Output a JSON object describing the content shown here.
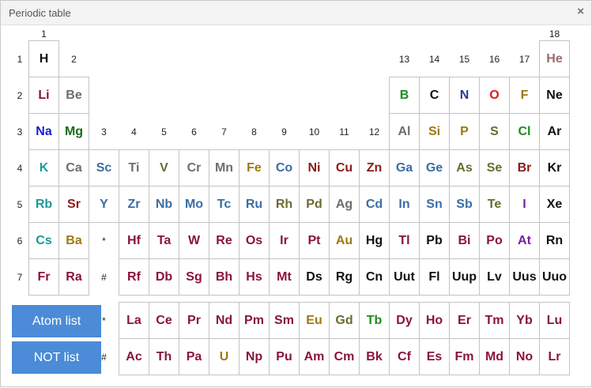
{
  "dialog": {
    "title": "Periodic table",
    "close_label": "×"
  },
  "buttons": {
    "atom_list": "Atom list",
    "not_list": "NOT list"
  },
  "group_labels": [
    "1",
    "2",
    "3",
    "4",
    "5",
    "6",
    "7",
    "8",
    "9",
    "10",
    "11",
    "12",
    "13",
    "14",
    "15",
    "16",
    "17",
    "18"
  ],
  "period_labels": [
    "1",
    "2",
    "3",
    "4",
    "5",
    "6",
    "7"
  ],
  "markers": {
    "lanthanide_row": "*",
    "actinide_row": "#"
  },
  "colors": {
    "dark": "#111111",
    "gray": "#6e6e6e",
    "maroon": "#8a1538",
    "steel": "#3a6ea5",
    "olive": "#6b6b2f",
    "teal": "#1a9a9a",
    "gold": "#a07810",
    "green": "#1e8c1e",
    "navy": "#2b3b8f",
    "red": "#e31a1a",
    "darkred": "#8b1a1a",
    "purple": "#7a1fa2",
    "mauve": "#9a6a6a",
    "blue": "#1a1ad0",
    "grayblue": "#7a8a9a",
    "darkgreen": "#1a6a1a"
  },
  "elements": [
    {
      "s": "H",
      "r": 1,
      "c": 1,
      "k": "dark"
    },
    {
      "s": "He",
      "r": 1,
      "c": 18,
      "k": "mauve"
    },
    {
      "s": "Li",
      "r": 2,
      "c": 1,
      "k": "maroon"
    },
    {
      "s": "Be",
      "r": 2,
      "c": 2,
      "k": "gray"
    },
    {
      "s": "B",
      "r": 2,
      "c": 13,
      "k": "green"
    },
    {
      "s": "C",
      "r": 2,
      "c": 14,
      "k": "dark"
    },
    {
      "s": "N",
      "r": 2,
      "c": 15,
      "k": "navy"
    },
    {
      "s": "O",
      "r": 2,
      "c": 16,
      "k": "red"
    },
    {
      "s": "F",
      "r": 2,
      "c": 17,
      "k": "gold"
    },
    {
      "s": "Ne",
      "r": 2,
      "c": 18,
      "k": "dark"
    },
    {
      "s": "Na",
      "r": 3,
      "c": 1,
      "k": "blue"
    },
    {
      "s": "Mg",
      "r": 3,
      "c": 2,
      "k": "darkgreen"
    },
    {
      "s": "Al",
      "r": 3,
      "c": 13,
      "k": "gray"
    },
    {
      "s": "Si",
      "r": 3,
      "c": 14,
      "k": "gold"
    },
    {
      "s": "P",
      "r": 3,
      "c": 15,
      "k": "gold"
    },
    {
      "s": "S",
      "r": 3,
      "c": 16,
      "k": "olive"
    },
    {
      "s": "Cl",
      "r": 3,
      "c": 17,
      "k": "green"
    },
    {
      "s": "Ar",
      "r": 3,
      "c": 18,
      "k": "dark"
    },
    {
      "s": "K",
      "r": 4,
      "c": 1,
      "k": "teal"
    },
    {
      "s": "Ca",
      "r": 4,
      "c": 2,
      "k": "gray"
    },
    {
      "s": "Sc",
      "r": 4,
      "c": 3,
      "k": "steel"
    },
    {
      "s": "Ti",
      "r": 4,
      "c": 4,
      "k": "gray"
    },
    {
      "s": "V",
      "r": 4,
      "c": 5,
      "k": "olive"
    },
    {
      "s": "Cr",
      "r": 4,
      "c": 6,
      "k": "gray"
    },
    {
      "s": "Mn",
      "r": 4,
      "c": 7,
      "k": "gray"
    },
    {
      "s": "Fe",
      "r": 4,
      "c": 8,
      "k": "gold"
    },
    {
      "s": "Co",
      "r": 4,
      "c": 9,
      "k": "steel"
    },
    {
      "s": "Ni",
      "r": 4,
      "c": 10,
      "k": "darkred"
    },
    {
      "s": "Cu",
      "r": 4,
      "c": 11,
      "k": "darkred"
    },
    {
      "s": "Zn",
      "r": 4,
      "c": 12,
      "k": "darkred"
    },
    {
      "s": "Ga",
      "r": 4,
      "c": 13,
      "k": "steel"
    },
    {
      "s": "Ge",
      "r": 4,
      "c": 14,
      "k": "steel"
    },
    {
      "s": "As",
      "r": 4,
      "c": 15,
      "k": "olive"
    },
    {
      "s": "Se",
      "r": 4,
      "c": 16,
      "k": "olive"
    },
    {
      "s": "Br",
      "r": 4,
      "c": 17,
      "k": "darkred"
    },
    {
      "s": "Kr",
      "r": 4,
      "c": 18,
      "k": "dark"
    },
    {
      "s": "Rb",
      "r": 5,
      "c": 1,
      "k": "teal"
    },
    {
      "s": "Sr",
      "r": 5,
      "c": 2,
      "k": "darkred"
    },
    {
      "s": "Y",
      "r": 5,
      "c": 3,
      "k": "steel"
    },
    {
      "s": "Zr",
      "r": 5,
      "c": 4,
      "k": "steel"
    },
    {
      "s": "Nb",
      "r": 5,
      "c": 5,
      "k": "steel"
    },
    {
      "s": "Mo",
      "r": 5,
      "c": 6,
      "k": "steel"
    },
    {
      "s": "Tc",
      "r": 5,
      "c": 7,
      "k": "steel"
    },
    {
      "s": "Ru",
      "r": 5,
      "c": 8,
      "k": "steel"
    },
    {
      "s": "Rh",
      "r": 5,
      "c": 9,
      "k": "olive"
    },
    {
      "s": "Pd",
      "r": 5,
      "c": 10,
      "k": "olive"
    },
    {
      "s": "Ag",
      "r": 5,
      "c": 11,
      "k": "gray"
    },
    {
      "s": "Cd",
      "r": 5,
      "c": 12,
      "k": "steel"
    },
    {
      "s": "In",
      "r": 5,
      "c": 13,
      "k": "steel"
    },
    {
      "s": "Sn",
      "r": 5,
      "c": 14,
      "k": "steel"
    },
    {
      "s": "Sb",
      "r": 5,
      "c": 15,
      "k": "steel"
    },
    {
      "s": "Te",
      "r": 5,
      "c": 16,
      "k": "olive"
    },
    {
      "s": "I",
      "r": 5,
      "c": 17,
      "k": "purple"
    },
    {
      "s": "Xe",
      "r": 5,
      "c": 18,
      "k": "dark"
    },
    {
      "s": "Cs",
      "r": 6,
      "c": 1,
      "k": "teal"
    },
    {
      "s": "Ba",
      "r": 6,
      "c": 2,
      "k": "gold"
    },
    {
      "s": "Hf",
      "r": 6,
      "c": 4,
      "k": "maroon"
    },
    {
      "s": "Ta",
      "r": 6,
      "c": 5,
      "k": "maroon"
    },
    {
      "s": "W",
      "r": 6,
      "c": 6,
      "k": "maroon"
    },
    {
      "s": "Re",
      "r": 6,
      "c": 7,
      "k": "maroon"
    },
    {
      "s": "Os",
      "r": 6,
      "c": 8,
      "k": "maroon"
    },
    {
      "s": "Ir",
      "r": 6,
      "c": 9,
      "k": "maroon"
    },
    {
      "s": "Pt",
      "r": 6,
      "c": 10,
      "k": "maroon"
    },
    {
      "s": "Au",
      "r": 6,
      "c": 11,
      "k": "gold"
    },
    {
      "s": "Hg",
      "r": 6,
      "c": 12,
      "k": "dark"
    },
    {
      "s": "Tl",
      "r": 6,
      "c": 13,
      "k": "maroon"
    },
    {
      "s": "Pb",
      "r": 6,
      "c": 14,
      "k": "dark"
    },
    {
      "s": "Bi",
      "r": 6,
      "c": 15,
      "k": "maroon"
    },
    {
      "s": "Po",
      "r": 6,
      "c": 16,
      "k": "maroon"
    },
    {
      "s": "At",
      "r": 6,
      "c": 17,
      "k": "purple"
    },
    {
      "s": "Rn",
      "r": 6,
      "c": 18,
      "k": "dark"
    },
    {
      "s": "Fr",
      "r": 7,
      "c": 1,
      "k": "maroon"
    },
    {
      "s": "Ra",
      "r": 7,
      "c": 2,
      "k": "maroon"
    },
    {
      "s": "Rf",
      "r": 7,
      "c": 4,
      "k": "maroon"
    },
    {
      "s": "Db",
      "r": 7,
      "c": 5,
      "k": "maroon"
    },
    {
      "s": "Sg",
      "r": 7,
      "c": 6,
      "k": "maroon"
    },
    {
      "s": "Bh",
      "r": 7,
      "c": 7,
      "k": "maroon"
    },
    {
      "s": "Hs",
      "r": 7,
      "c": 8,
      "k": "maroon"
    },
    {
      "s": "Mt",
      "r": 7,
      "c": 9,
      "k": "maroon"
    },
    {
      "s": "Ds",
      "r": 7,
      "c": 10,
      "k": "dark"
    },
    {
      "s": "Rg",
      "r": 7,
      "c": 11,
      "k": "dark"
    },
    {
      "s": "Cn",
      "r": 7,
      "c": 12,
      "k": "dark"
    },
    {
      "s": "Uut",
      "r": 7,
      "c": 13,
      "k": "dark"
    },
    {
      "s": "Fl",
      "r": 7,
      "c": 14,
      "k": "dark"
    },
    {
      "s": "Uup",
      "r": 7,
      "c": 15,
      "k": "dark"
    },
    {
      "s": "Lv",
      "r": 7,
      "c": 16,
      "k": "dark"
    },
    {
      "s": "Uus",
      "r": 7,
      "c": 17,
      "k": "dark"
    },
    {
      "s": "Uuo",
      "r": 7,
      "c": 18,
      "k": "dark"
    },
    {
      "s": "La",
      "r": 8,
      "c": 4,
      "k": "maroon"
    },
    {
      "s": "Ce",
      "r": 8,
      "c": 5,
      "k": "maroon"
    },
    {
      "s": "Pr",
      "r": 8,
      "c": 6,
      "k": "maroon"
    },
    {
      "s": "Nd",
      "r": 8,
      "c": 7,
      "k": "maroon"
    },
    {
      "s": "Pm",
      "r": 8,
      "c": 8,
      "k": "maroon"
    },
    {
      "s": "Sm",
      "r": 8,
      "c": 9,
      "k": "maroon"
    },
    {
      "s": "Eu",
      "r": 8,
      "c": 10,
      "k": "gold"
    },
    {
      "s": "Gd",
      "r": 8,
      "c": 11,
      "k": "olive"
    },
    {
      "s": "Tb",
      "r": 8,
      "c": 12,
      "k": "green"
    },
    {
      "s": "Dy",
      "r": 8,
      "c": 13,
      "k": "maroon"
    },
    {
      "s": "Ho",
      "r": 8,
      "c": 14,
      "k": "maroon"
    },
    {
      "s": "Er",
      "r": 8,
      "c": 15,
      "k": "maroon"
    },
    {
      "s": "Tm",
      "r": 8,
      "c": 16,
      "k": "maroon"
    },
    {
      "s": "Yb",
      "r": 8,
      "c": 17,
      "k": "maroon"
    },
    {
      "s": "Lu",
      "r": 8,
      "c": 18,
      "k": "maroon"
    },
    {
      "s": "Ac",
      "r": 9,
      "c": 4,
      "k": "maroon"
    },
    {
      "s": "Th",
      "r": 9,
      "c": 5,
      "k": "maroon"
    },
    {
      "s": "Pa",
      "r": 9,
      "c": 6,
      "k": "maroon"
    },
    {
      "s": "U",
      "r": 9,
      "c": 7,
      "k": "gold"
    },
    {
      "s": "Np",
      "r": 9,
      "c": 8,
      "k": "maroon"
    },
    {
      "s": "Pu",
      "r": 9,
      "c": 9,
      "k": "maroon"
    },
    {
      "s": "Am",
      "r": 9,
      "c": 10,
      "k": "maroon"
    },
    {
      "s": "Cm",
      "r": 9,
      "c": 11,
      "k": "maroon"
    },
    {
      "s": "Bk",
      "r": 9,
      "c": 12,
      "k": "maroon"
    },
    {
      "s": "Cf",
      "r": 9,
      "c": 13,
      "k": "maroon"
    },
    {
      "s": "Es",
      "r": 9,
      "c": 14,
      "k": "maroon"
    },
    {
      "s": "Fm",
      "r": 9,
      "c": 15,
      "k": "maroon"
    },
    {
      "s": "Md",
      "r": 9,
      "c": 16,
      "k": "maroon"
    },
    {
      "s": "No",
      "r": 9,
      "c": 17,
      "k": "maroon"
    },
    {
      "s": "Lr",
      "r": 9,
      "c": 18,
      "k": "maroon"
    }
  ]
}
